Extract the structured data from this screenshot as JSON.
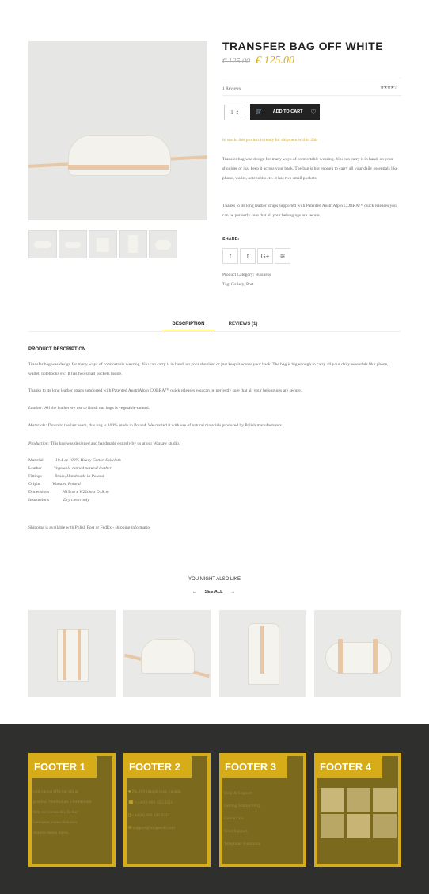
{
  "product": {
    "title": "TRANSFER BAG OFF WHITE",
    "old_price": "€ 125.00",
    "price": "€ 125.00",
    "reviews_link": "1 Reviews",
    "quantity": "1",
    "add_to_cart": "ADD TO CART",
    "stock": "In stock: this product is ready for shipment within 24h",
    "desc1": "Transfer bag was design for many ways of comfortable wearing. You can carry it in hand, on your shoulder or just keep it across your back. The bag is big enough to carry all your daily essentials like phone, wallet, notebooks etc. It has two small pockets",
    "desc2": "Thanks to its long leather straps supported with Patented AustriAlpin COBRA™ quick releases you can be perfectly sure that all your belongings are secure.",
    "share_label": "SHARE:",
    "category": "Product Category: Business",
    "tags": "Tag: Gallery, Post"
  },
  "tabs": {
    "description": "DESCRIPTION",
    "reviews": "REVIEWS (1)"
  },
  "description": {
    "heading": "PRODUCT DESCRIPTION",
    "p1": "Transfer bag was design for many ways of comfortable wearing. You can carry it in hand, on your shoulder or just keep it across your back. The bag is big enough to carry all your daily essentials like phone, wallet, notebooks etc. It has two small pockets inside.",
    "p2": "Thanks to its long leather straps supported with Patented AustriAlpin COBRA™ quick releases you can be perfectly sure that all your belongings are secure.",
    "leather_label": "Leather:",
    "leather_text": "All the leather we use to finish our bags is vegetable-tanned.",
    "materials_label": "Materials:",
    "materials_text": "Down to the last seam, this bag is 100% made in Poland. We crafted it with use of natural materials produced by Polish manufacturers.",
    "production_label": "Production:",
    "production_text": "This bag was designed and handmade entirely by us at our Warsaw studio.",
    "specs": [
      {
        "k": "Material",
        "v": "19.4 oz 100% Heavy Cotton Sailcloth"
      },
      {
        "k": "Leather",
        "v": "Vegetable-tanned natural leather"
      },
      {
        "k": "Fittings",
        "v": "Brass, Handmade in Poland"
      },
      {
        "k": "Origin",
        "v": "Warsaw, Poland"
      },
      {
        "k": "Dimensions",
        "v": "H15cm x W22cm x D18cm"
      },
      {
        "k": "Instructions",
        "v": "Dry clean only"
      }
    ],
    "shipping": "Shipping is available with Polish Post or FedEx - shipping informatio"
  },
  "related": {
    "heading": "YOU MIGHT ALSO LIKE",
    "see_all": "SEE ALL",
    "prev": "←",
    "next": "→"
  },
  "footer": {
    "titles": [
      "FOOTER 1",
      "FOOTER 2",
      "FOOTER 3",
      "FOOTER 4"
    ],
    "col1": [
      "odit cursus efficitur elit at",
      "gravida. Vestibulum a fermentum",
      "felt, vel varius dui. In hac",
      "habitasse platea dictumst.",
      "Mauris metus libero."
    ],
    "col2": [
      "No.200 Joseph road, canada",
      "+44 (0) 800 163 4321",
      "+44 (0) 800 163 4321",
      "support@loopasoft.com"
    ],
    "col3": [
      "Help & Support",
      "Getting Started FAQ",
      "Contact Us",
      "Send Support",
      "Telephone Functions"
    ]
  },
  "colors": {
    "accent": "#d6ac18",
    "footer_bg": "#2f2f2e",
    "price": "#d6ac18"
  }
}
